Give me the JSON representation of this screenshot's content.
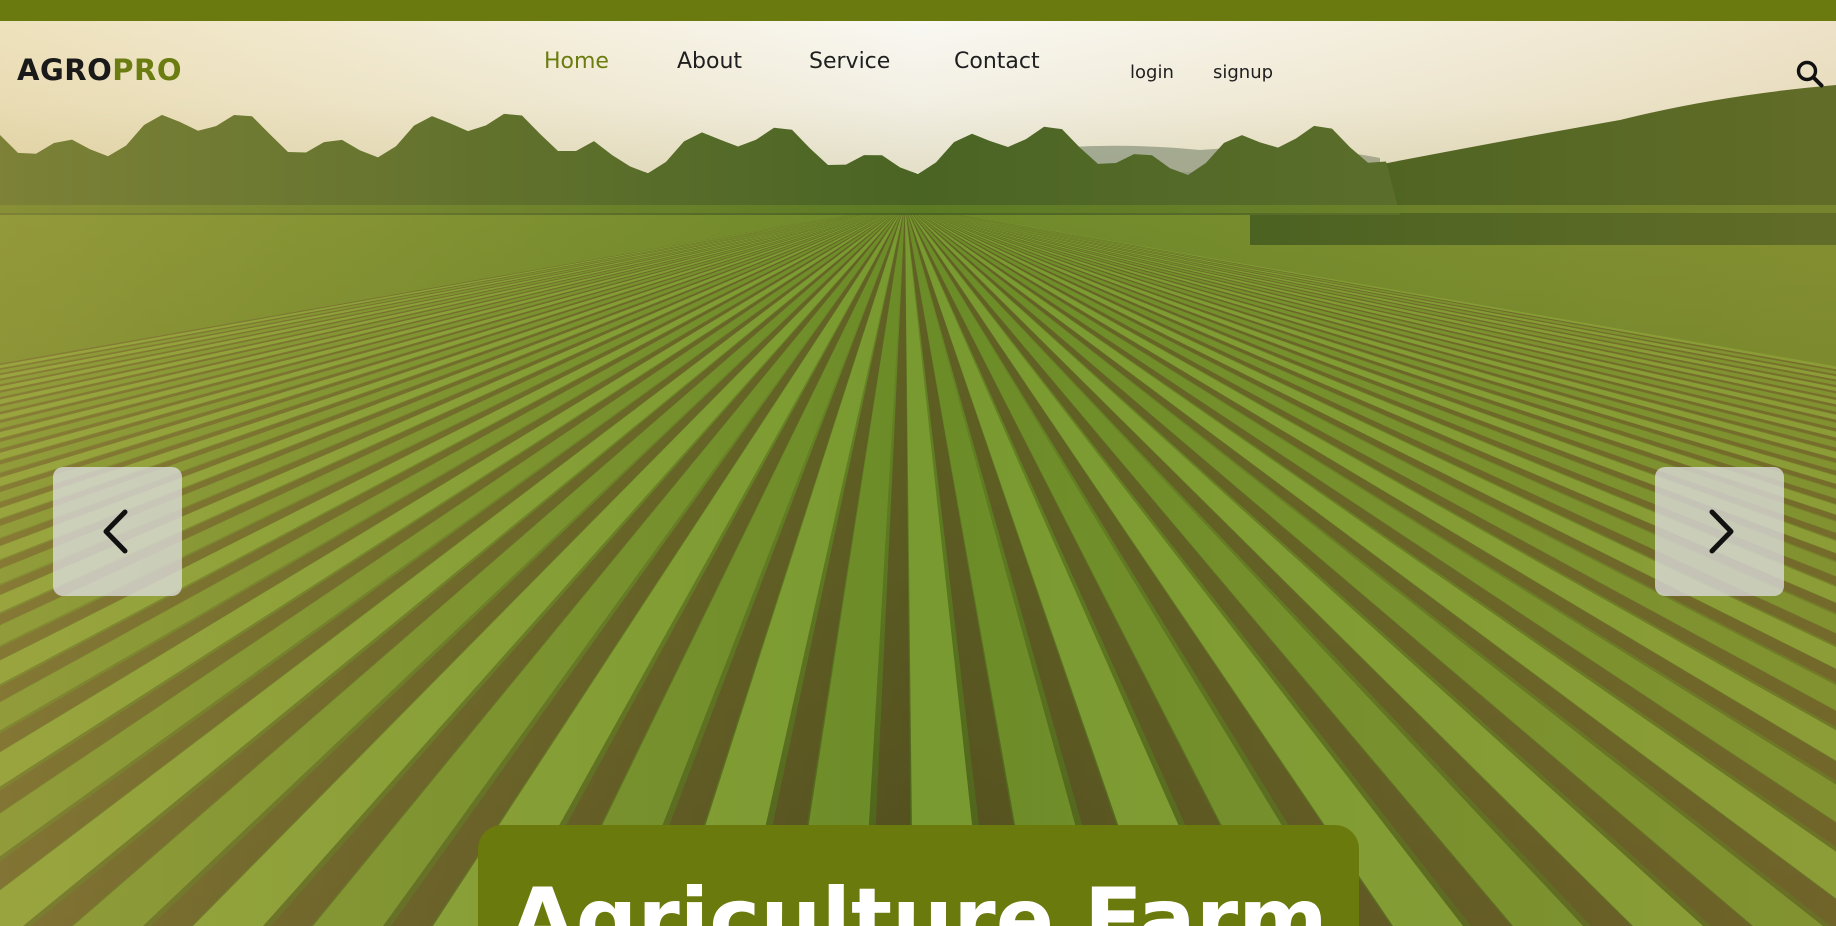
{
  "brand": {
    "logo_primary": "AGRO",
    "logo_accent": "PRO",
    "accent_color": "#6b7d10"
  },
  "nav": {
    "items": [
      {
        "label": "Home",
        "active": true
      },
      {
        "label": "About",
        "active": false
      },
      {
        "label": "Service",
        "active": false
      },
      {
        "label": "Contact",
        "active": false
      }
    ]
  },
  "auth": {
    "login_label": "login",
    "signup_label": "signup"
  },
  "header": {
    "search_icon": "search-icon"
  },
  "carousel": {
    "prev_icon": "chevron-left-icon",
    "next_icon": "chevron-right-icon"
  },
  "hero": {
    "title": "Agriculture Farm",
    "background": "photo of green crop rows in a farm field at sunset"
  }
}
